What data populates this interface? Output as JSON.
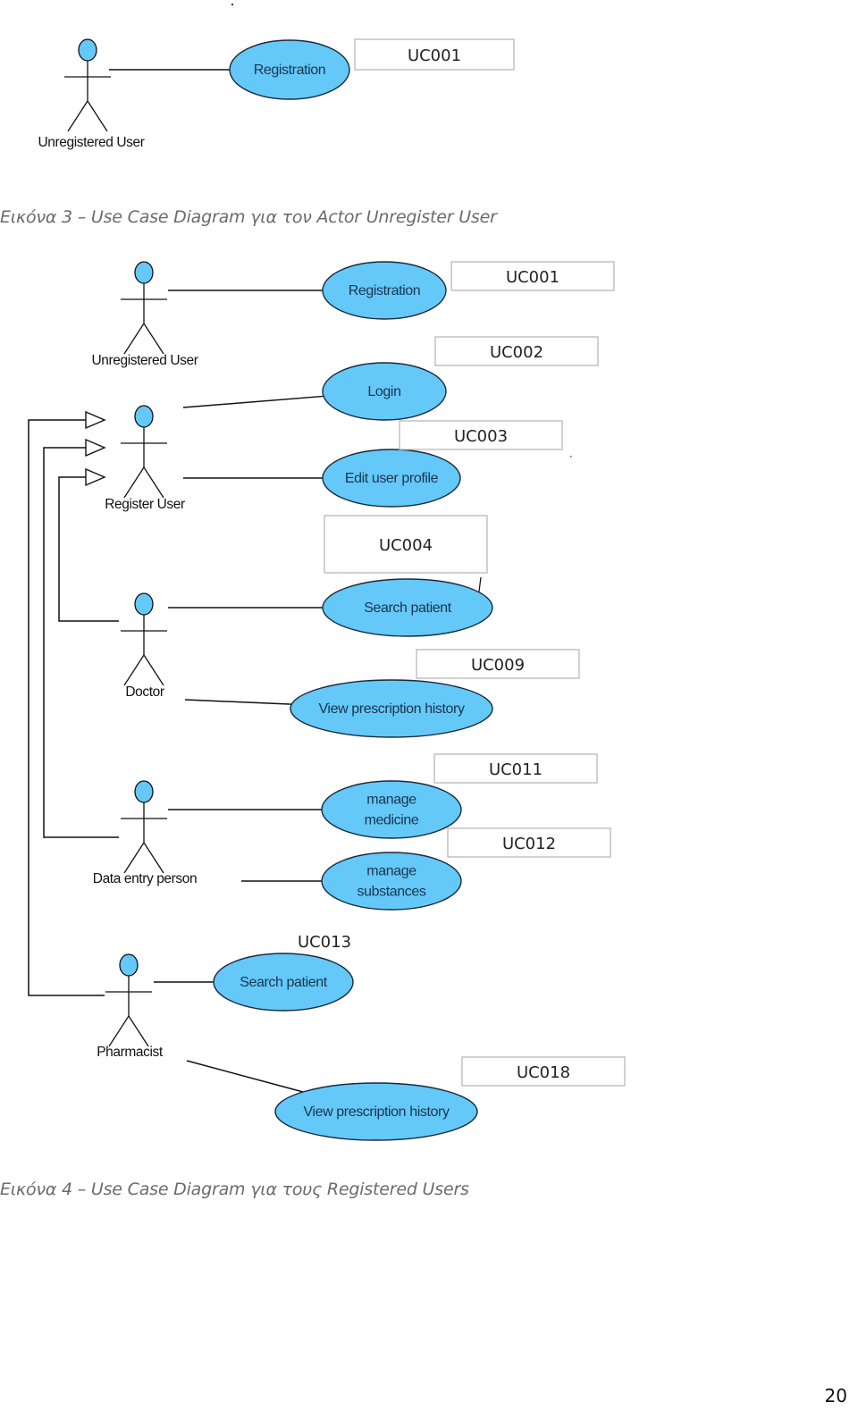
{
  "colors": {
    "usecase_fill": "#64c8f8",
    "usecase_stroke": "#1a2a3a",
    "usecase_text": "#1a3550",
    "actor_head_fill": "#64c8f8",
    "line": "#111111",
    "id_box_border": "#b8b8b8",
    "caption_text": "#6b6b6b"
  },
  "figure3": {
    "caption": "Εικόνα 3 – Use Case Diagram για τον Actor Unregister User",
    "actors": [
      {
        "id": "unregistered-user",
        "label": "Unregistered User"
      }
    ],
    "use_cases": [
      {
        "id": "registration",
        "label": "Registration",
        "code": "UC001"
      }
    ],
    "associations": [
      {
        "actor": "unregistered-user",
        "use_case": "registration"
      }
    ]
  },
  "figure4": {
    "caption": "Εικόνα 4 – Use Case Diagram για τους Registered Users",
    "actors": [
      {
        "id": "unregistered-user",
        "label": "Unregistered User"
      },
      {
        "id": "register-user",
        "label": "Register User"
      },
      {
        "id": "doctor",
        "label": "Doctor"
      },
      {
        "id": "data-entry-person",
        "label": "Data entry person"
      },
      {
        "id": "pharmacist",
        "label": "Pharmacist"
      }
    ],
    "use_cases": [
      {
        "id": "registration",
        "label": [
          "Registration"
        ],
        "code": "UC001"
      },
      {
        "id": "login",
        "label": [
          "Login"
        ],
        "code": "UC002"
      },
      {
        "id": "edit-user-profile",
        "label": [
          "Edit user profile"
        ],
        "code": "UC003"
      },
      {
        "id": "doctor-search-patient",
        "label": [
          "Search patient"
        ],
        "code": "UC004"
      },
      {
        "id": "doctor-view-prescription-history",
        "label": [
          "View prescription history"
        ],
        "code": "UC009"
      },
      {
        "id": "manage-medicine",
        "label": [
          "manage",
          "medicine"
        ],
        "code": "UC011"
      },
      {
        "id": "manage-substances",
        "label": [
          "manage",
          "substances"
        ],
        "code": "UC012"
      },
      {
        "id": "pharmacist-search-patient",
        "label": [
          "Search patient"
        ],
        "code": "UC013"
      },
      {
        "id": "pharmacist-view-prescription-history",
        "label": [
          "View prescription history"
        ],
        "code": "UC018"
      }
    ],
    "associations": [
      {
        "actor": "unregistered-user",
        "use_case": "registration"
      },
      {
        "actor": "register-user",
        "use_case": "login"
      },
      {
        "actor": "register-user",
        "use_case": "edit-user-profile"
      },
      {
        "actor": "doctor",
        "use_case": "doctor-search-patient"
      },
      {
        "actor": "doctor",
        "use_case": "doctor-view-prescription-history"
      },
      {
        "actor": "data-entry-person",
        "use_case": "manage-medicine"
      },
      {
        "actor": "data-entry-person",
        "use_case": "manage-substances"
      },
      {
        "actor": "pharmacist",
        "use_case": "pharmacist-search-patient"
      },
      {
        "actor": "pharmacist",
        "use_case": "pharmacist-view-prescription-history"
      }
    ],
    "generalizations": [
      {
        "child": "doctor",
        "parent": "register-user"
      },
      {
        "child": "data-entry-person",
        "parent": "register-user"
      },
      {
        "child": "pharmacist",
        "parent": "register-user"
      }
    ]
  },
  "page_number": "20"
}
